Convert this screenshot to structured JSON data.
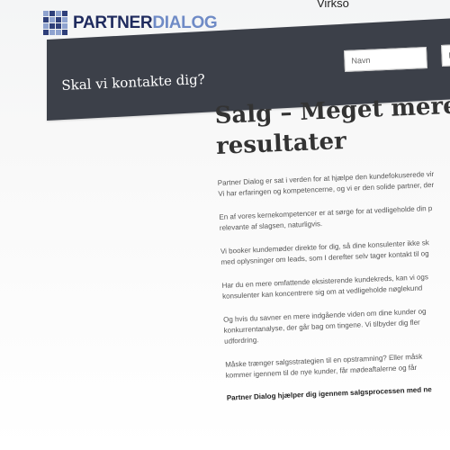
{
  "header": {
    "logo_part1": "PARTNER",
    "logo_part2": "DIALOG",
    "nav_link": "Virkso"
  },
  "contact": {
    "title": "Skal vi kontakte dig?",
    "name_placeholder": "Navn",
    "email_placeholder": "E"
  },
  "article": {
    "headline_line1": "Salg – Meget mere en",
    "headline_line2": "resultater",
    "paragraphs": [
      [
        "Partner Dialog er sat i verden for at hjælpe den kundefokuserede vir",
        "Vi har erfaringen og kompetencerne, og vi er den solide partner, der"
      ],
      [
        "En af vores kernekompetencer er at sørge for at vedligeholde din p",
        "relevante af slagsen, naturligvis."
      ],
      [
        "Vi booker kundemøder direkte for dig, så dine konsulenter ikke sk",
        "med oplysninger om leads, som I derefter selv tager kontakt til og"
      ],
      [
        "Har du en mere omfattende eksisterende kundekreds, kan vi ogs",
        "konsulenter kan koncentrere sig om at vedligeholde nøglekund"
      ],
      [
        "Og hvis du savner en mere indgående viden om dine kunder og",
        "konkurrentanalyse, der går bag om tingene. Vi tilbyder dig fler",
        "udfordring."
      ],
      [
        "Måske trænger salgsstrategien til en opstramning? Eller måsk",
        "kommer igennem til de nye kunder, får mødeaftalerne og får"
      ]
    ],
    "closing": "Partner Dialog hjælper dig igennem salgsprocessen med ne"
  },
  "colors": {
    "bar": "#3c4049",
    "logo_dark": "#1f2b5e",
    "logo_light": "#6f8bc6"
  }
}
